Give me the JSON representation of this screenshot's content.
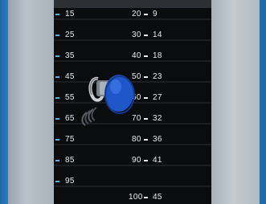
{
  "stack": {
    "left_column": [
      "15",
      "25",
      "35",
      "45",
      "55",
      "65",
      "75",
      "85",
      "95"
    ],
    "right_column": [
      {
        "lbs": "20",
        "kg": "9"
      },
      {
        "lbs": "30",
        "kg": "14"
      },
      {
        "lbs": "40",
        "kg": "18"
      },
      {
        "lbs": "50",
        "kg": "23"
      },
      {
        "lbs": "60",
        "kg": "27"
      },
      {
        "lbs": "70",
        "kg": "32"
      },
      {
        "lbs": "80",
        "kg": "36"
      },
      {
        "lbs": "90",
        "kg": "41"
      },
      {
        "lbs": "100",
        "kg": "45"
      }
    ]
  },
  "colors": {
    "background": "#1f6fb0",
    "frame": "#b3bcc3",
    "plates": "#0b0c0e",
    "pin_knob": "#1f56c8",
    "label_tick": "#5ab0e0"
  },
  "icons": {
    "pin": "selector-pin-icon"
  }
}
